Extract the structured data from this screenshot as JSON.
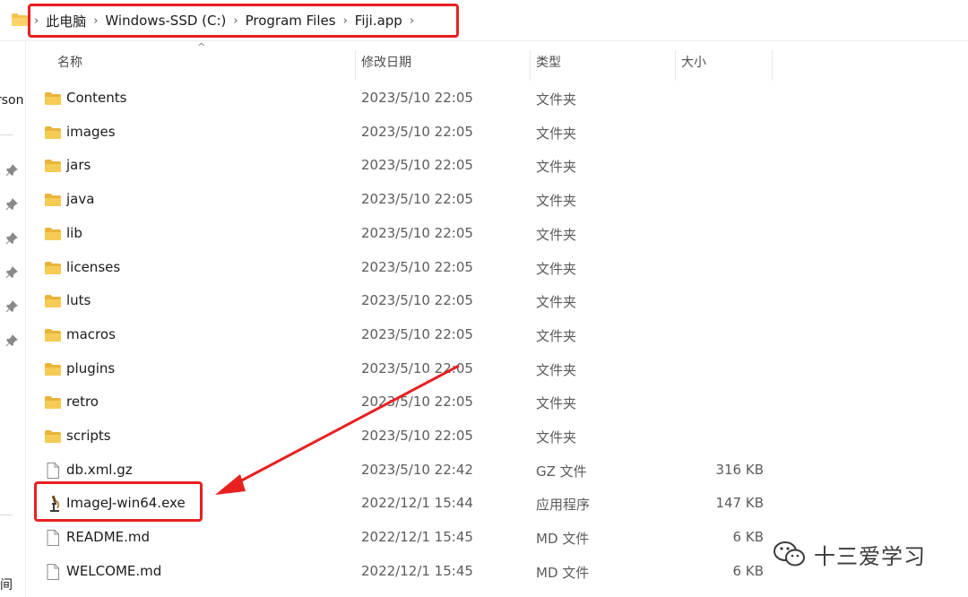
{
  "breadcrumb": {
    "items": [
      "此电脑",
      "Windows-SSD (C:)",
      "Program Files",
      "Fiji.app"
    ]
  },
  "nav": {
    "cut_top": "rson",
    "cut_bottom": "间"
  },
  "columns": {
    "name": "名称",
    "date": "修改日期",
    "type": "类型",
    "size": "大小"
  },
  "files": [
    {
      "name": "Contents",
      "date": "2023/5/10 22:05",
      "type": "文件夹",
      "size": "",
      "icon": "folder-icon"
    },
    {
      "name": "images",
      "date": "2023/5/10 22:05",
      "type": "文件夹",
      "size": "",
      "icon": "folder-icon"
    },
    {
      "name": "jars",
      "date": "2023/5/10 22:05",
      "type": "文件夹",
      "size": "",
      "icon": "folder-icon"
    },
    {
      "name": "java",
      "date": "2023/5/10 22:05",
      "type": "文件夹",
      "size": "",
      "icon": "folder-icon"
    },
    {
      "name": "lib",
      "date": "2023/5/10 22:05",
      "type": "文件夹",
      "size": "",
      "icon": "folder-icon"
    },
    {
      "name": "licenses",
      "date": "2023/5/10 22:05",
      "type": "文件夹",
      "size": "",
      "icon": "folder-icon"
    },
    {
      "name": "luts",
      "date": "2023/5/10 22:05",
      "type": "文件夹",
      "size": "",
      "icon": "folder-icon"
    },
    {
      "name": "macros",
      "date": "2023/5/10 22:05",
      "type": "文件夹",
      "size": "",
      "icon": "folder-icon"
    },
    {
      "name": "plugins",
      "date": "2023/5/10 22:05",
      "type": "文件夹",
      "size": "",
      "icon": "folder-icon"
    },
    {
      "name": "retro",
      "date": "2023/5/10 22:05",
      "type": "文件夹",
      "size": "",
      "icon": "folder-icon"
    },
    {
      "name": "scripts",
      "date": "2023/5/10 22:05",
      "type": "文件夹",
      "size": "",
      "icon": "folder-icon"
    },
    {
      "name": "db.xml.gz",
      "date": "2023/5/10 22:42",
      "type": "GZ 文件",
      "size": "316 KB",
      "icon": "file-icon"
    },
    {
      "name": "ImageJ-win64.exe",
      "date": "2022/12/1 15:44",
      "type": "应用程序",
      "size": "147 KB",
      "icon": "microscope-icon"
    },
    {
      "name": "README.md",
      "date": "2022/12/1 15:45",
      "type": "MD 文件",
      "size": "6 KB",
      "icon": "file-icon"
    },
    {
      "name": "WELCOME.md",
      "date": "2022/12/1 15:45",
      "type": "MD 文件",
      "size": "6 KB",
      "icon": "file-icon"
    }
  ],
  "watermark": {
    "text": "十三爱学习"
  },
  "colors": {
    "annotation": "#e82020",
    "folder": "#f4c34d"
  }
}
